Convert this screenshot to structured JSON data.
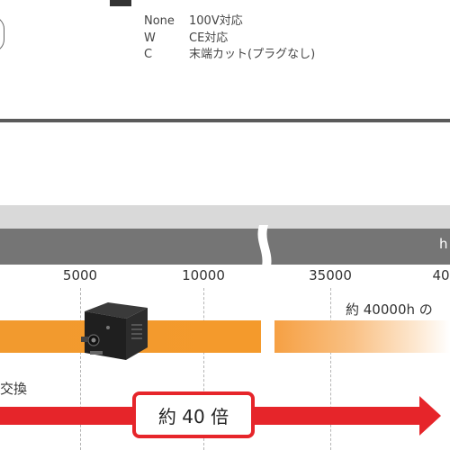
{
  "options": [
    {
      "code": "None",
      "desc": "100V対応"
    },
    {
      "code": "W",
      "desc": "CE対応"
    },
    {
      "code": "C",
      "desc": "末端カット(プラグなし)"
    }
  ],
  "timeline": {
    "unit": "h",
    "ticks": [
      "5000",
      "10000",
      "35000",
      "40"
    ]
  },
  "life_label": "約 40000h の",
  "swap_label": "交換",
  "multiplier_label": "約 40 倍",
  "colors": {
    "orange": "#f29a2e",
    "red": "#e6252a",
    "band_dark": "#757575",
    "band_light": "#d9d9d9"
  }
}
